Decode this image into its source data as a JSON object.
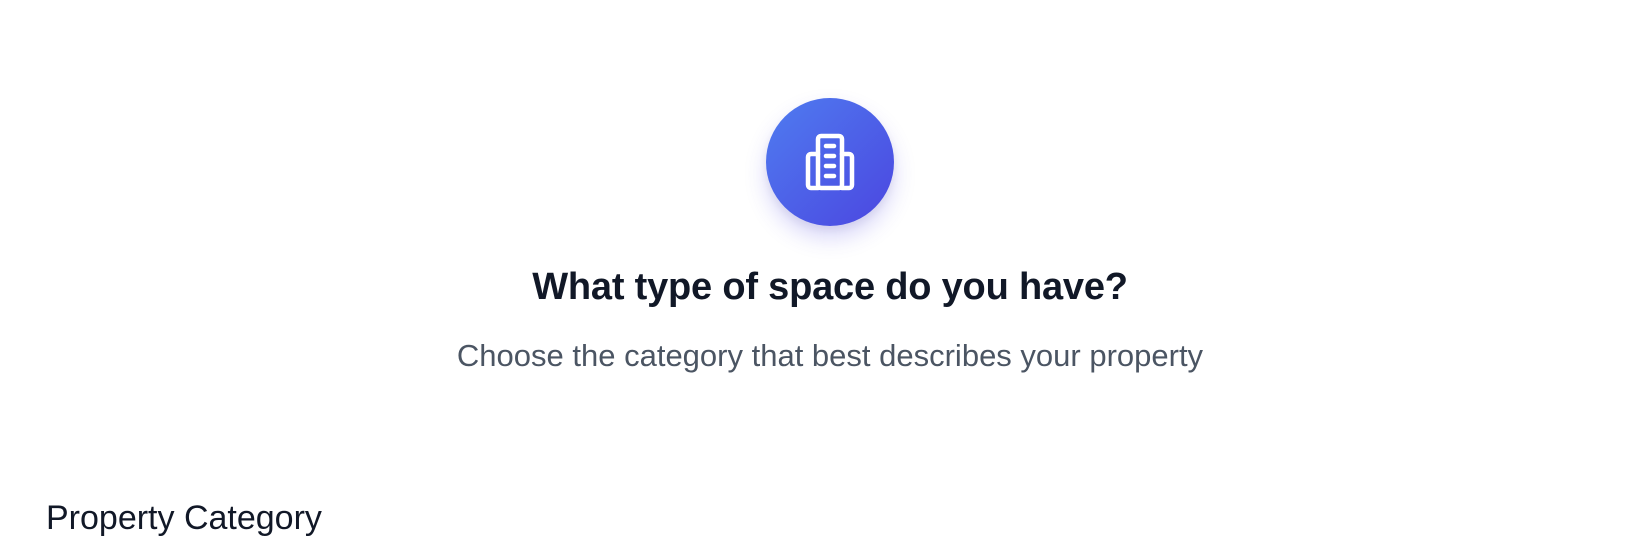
{
  "hero": {
    "icon": "building-icon",
    "title": "What type of space do you have?",
    "subtitle": "Choose the category that best describes your property"
  },
  "form": {
    "category_label": "Property Category"
  },
  "colors": {
    "accent_start": "#4f7cf0",
    "accent_end": "#4b46e0",
    "title": "#111827",
    "subtitle": "#4b5563"
  }
}
